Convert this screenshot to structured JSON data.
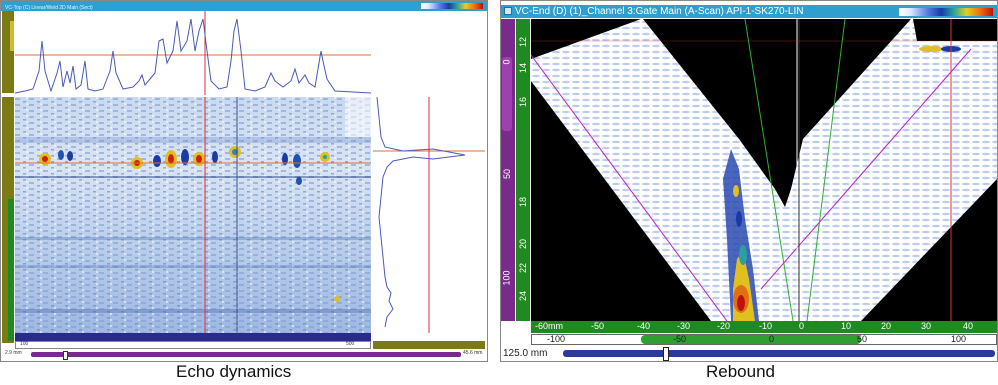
{
  "left_panel": {
    "title": "VC-Top (C) Linear/Weld 2D Main (Sect)",
    "depth_start": "2.9 mm",
    "depth_end": "45.6 mm",
    "bottom_scale_start": "100",
    "bottom_scale_end": "500"
  },
  "right_panel": {
    "title": "VC-End (D) (1)_Channel 3:Gate Main (A-Scan) API-1-SK270-LIN",
    "vertical_ruler_labels": [
      "12",
      "14",
      "16",
      "18",
      "20",
      "22",
      "24"
    ],
    "purple_ruler_labels": [
      "0",
      "50",
      "100"
    ],
    "horizontal_ruler_labels": [
      "-60mm",
      "-50",
      "-40",
      "-30",
      "-20",
      "-10",
      "0",
      "10",
      "20",
      "30",
      "40"
    ],
    "bottom_ruler_labels": [
      "-100",
      "-50",
      "0",
      "50",
      "100"
    ],
    "range_label": "125.0 mm"
  },
  "captions": {
    "left": "Echo dynamics",
    "right": "Rebound"
  },
  "colors": {
    "title_bar": "#2f9fd0",
    "cursor_red": "#e03030",
    "cursor_green": "#2fb02f",
    "cursor_magenta": "#c020c0",
    "trace_blue": "#4a5ab8"
  }
}
